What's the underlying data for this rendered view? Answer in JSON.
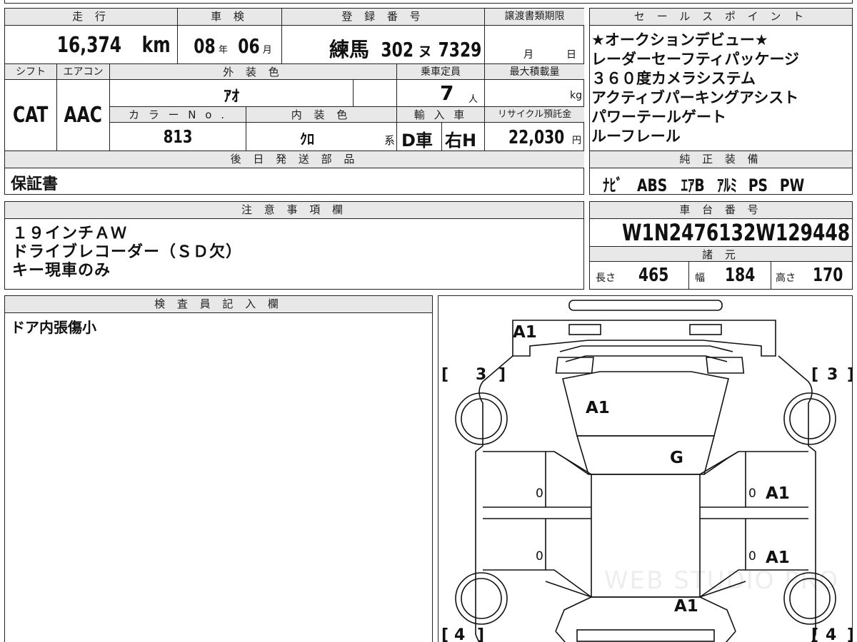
{
  "headers": {
    "mileage": "走 行",
    "inspection": "車 検",
    "registration": "登 録 番 号",
    "transfer_deadline": "譲渡書類期限",
    "shift": "シフト",
    "aircon": "エアコン",
    "exterior_color": "外 装 色",
    "capacity": "乗車定員",
    "max_load": "最大積載量",
    "color_no": "カ ラ ー N o .",
    "interior_color": "内 装 色",
    "import": "輸 入 車",
    "recycle_fee": "リサイクル預託金",
    "later_parts": "後 日 発 送 部 品",
    "sales_points": "セ ー ル ス ポ イ ン ト",
    "genuine_equipment": "純 正 装 備",
    "notes": "注 意 事 項 欄",
    "chassis_no": "車 台 番 号",
    "specs": "諸 元",
    "inspector": "検 査 員 記 入 欄"
  },
  "vehicle": {
    "mileage_value": "16,374",
    "mileage_unit": "km",
    "inspection_year": "08",
    "inspection_year_unit": "年",
    "inspection_month": "06",
    "inspection_month_unit": "月",
    "registration_area": "練馬",
    "registration_number": "302",
    "registration_kana": "ヌ",
    "registration_plate": "7329",
    "transfer_month_unit": "月",
    "transfer_day_unit": "日",
    "shift": "CAT",
    "aircon": "AAC",
    "exterior_color": "ｱｵ",
    "capacity_value": "7",
    "capacity_unit": "人",
    "max_load_unit": "kg",
    "color_no": "813",
    "interior_color": "ｸﾛ",
    "interior_suffix": "系",
    "import_type": "D車",
    "handle": "右H",
    "recycle_value": "22,030",
    "recycle_unit": "円",
    "later_parts": "保証書"
  },
  "sales_points": [
    "★オークションデビュー★",
    "レーダーセーフティパッケージ",
    "３６０度カメラシステム",
    "アクティブパーキングアシスト",
    "パワーテールゲート",
    "ルーフレール"
  ],
  "genuine_equipment": [
    "ﾅﾋﾞ",
    "ABS",
    "ｴｱB",
    "ｱﾙﾐ",
    "PS",
    "PW"
  ],
  "notes": [
    "１９インチＡＷ",
    "ドライブレコーダー（ＳＤ欠）",
    "キー現車のみ"
  ],
  "chassis_no": "W1N2476132W129448",
  "specs": {
    "length_label": "長さ",
    "length": "465",
    "width_label": "幅",
    "width": "184",
    "height_label": "高さ",
    "height": "170"
  },
  "inspector_comment": "ドア内張傷小",
  "diagram": {
    "marks": {
      "rear_gate": "A1",
      "rear_glass": "A1",
      "roof": "G",
      "right_rear_door": "A1",
      "right_front_door": "A1",
      "hood": "A1"
    },
    "tire_labels": {
      "left_rear": "3",
      "right_rear": "3",
      "left_front": "4",
      "right_front": "4"
    },
    "door_digit": "0",
    "watermark": "WEB STUDIO PRO"
  }
}
